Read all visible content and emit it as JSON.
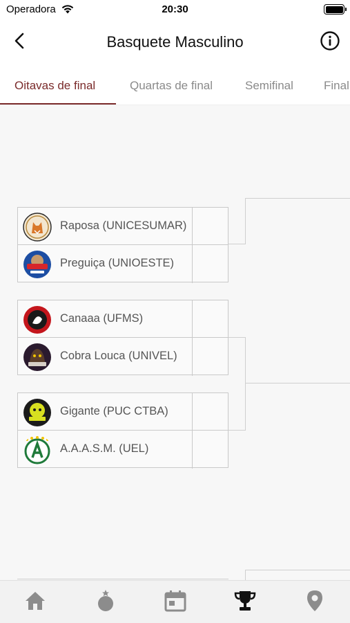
{
  "status_bar": {
    "carrier": "Operadora",
    "time": "20:30"
  },
  "header": {
    "title": "Basquete Masculino",
    "back_icon": "chevron-left-icon",
    "info_icon": "info-icon"
  },
  "tabs": [
    {
      "label": "Oitavas de final",
      "active": true
    },
    {
      "label": "Quartas de final",
      "active": false
    },
    {
      "label": "Semifinal",
      "active": false
    },
    {
      "label": "Final",
      "active": false
    }
  ],
  "bracket": {
    "matches": [
      {
        "teams": [
          {
            "name": "Raposa (UNICESUMAR)",
            "score": ""
          },
          {
            "name": "Preguiça (UNIOESTE)",
            "score": ""
          }
        ]
      },
      {
        "teams": [
          {
            "name": "Canaaa (UFMS)",
            "score": ""
          },
          {
            "name": "Cobra Louca (UNIVEL)",
            "score": ""
          }
        ]
      },
      {
        "teams": [
          {
            "name": "Gigante (PUC CTBA)",
            "score": ""
          },
          {
            "name": "A.A.A.S.M. (UEL)",
            "score": ""
          }
        ]
      }
    ]
  },
  "bottom_nav": [
    {
      "icon": "home-icon",
      "active": false
    },
    {
      "icon": "medal-icon",
      "active": false
    },
    {
      "icon": "calendar-icon",
      "active": false
    },
    {
      "icon": "trophy-icon",
      "active": true
    },
    {
      "icon": "location-pin-icon",
      "active": false
    }
  ],
  "colors": {
    "accent": "#7a2a2a",
    "inactive_tab": "#8a8a8a",
    "nav_icon": "#8c8c8c",
    "nav_icon_active": "#111111"
  }
}
